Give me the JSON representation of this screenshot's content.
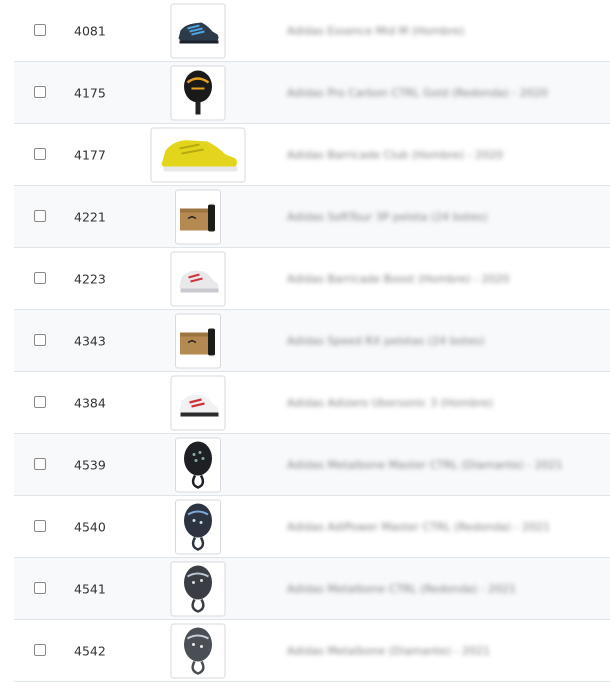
{
  "rows": [
    {
      "id": "4081",
      "name": "Adidas Essence Mid M (Hombre)",
      "image": "sneaker-dark-blue-icon"
    },
    {
      "id": "4175",
      "name": "Adidas Pro Carbon CTRL Gold (Redonda) - 2020",
      "image": "padel-racket-black-gold-icon"
    },
    {
      "id": "4177",
      "name": "Adidas Barricade Club (Hombre) - 2020",
      "image": "sneaker-yellow-icon"
    },
    {
      "id": "4221",
      "name": "Adidas SoftTour 3P pelota (24 botes)",
      "image": "ball-box-icon"
    },
    {
      "id": "4223",
      "name": "Adidas Barricade Boost (Hombre) - 2020",
      "image": "sneaker-white-red-icon"
    },
    {
      "id": "4343",
      "name": "Adidas Speed RX pelotas (24 botes)",
      "image": "ball-box-icon"
    },
    {
      "id": "4384",
      "name": "Adidas Adizero Ubersonic 3 (Hombre)",
      "image": "sneaker-white-red-icon"
    },
    {
      "id": "4539",
      "name": "Adidas Metalbone Master CTRL (Diamante) - 2021",
      "image": "padel-racket-black-icon"
    },
    {
      "id": "4540",
      "name": "Adidas AdiPower Master CTRL (Redonda) - 2021",
      "image": "padel-racket-blue-icon"
    },
    {
      "id": "4541",
      "name": "Adidas Metalbone CTRL (Redonda) - 2021",
      "image": "padel-racket-grey-icon"
    },
    {
      "id": "4542",
      "name": "Adidas Metalbone (Diamante) - 2021",
      "image": "padel-racket-grey-icon"
    }
  ]
}
